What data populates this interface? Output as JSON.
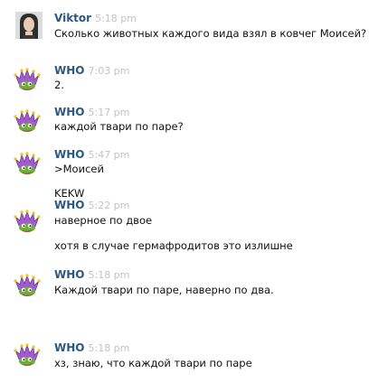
{
  "messages": [
    {
      "author": "Viktor",
      "time": "5:18 pm",
      "lines": [
        "Сколько животных каждого вида взял в ковчег Моисей?"
      ],
      "avatar": "woman-photo-avatar"
    },
    {
      "author": "WHO",
      "time": "7:03 pm",
      "lines": [
        "2."
      ],
      "avatar": "pepe-jester-avatar"
    },
    {
      "author": "WHO",
      "time": "5:17 pm",
      "lines": [
        "каждой твари по паре?"
      ],
      "avatar": "pepe-jester-avatar"
    },
    {
      "author": "WHO",
      "time": "5:47 pm",
      "lines": [
        ">Моисей",
        "KEKW"
      ],
      "avatar": "pepe-jester-avatar"
    },
    {
      "author": "WHO",
      "time": "5:22 pm",
      "lines": [
        "наверное по двое",
        "хотя в случае гермафродитов это излишне"
      ],
      "avatar": "pepe-jester-avatar"
    },
    {
      "author": "WHO",
      "time": "5:18 pm",
      "lines": [
        "Каждой твари по паре, наверно по два."
      ],
      "avatar": "pepe-jester-avatar"
    },
    {
      "author": "WHO",
      "time": "5:18 pm",
      "lines": [
        "хз, знаю, что каждой твари по паре"
      ],
      "avatar": "pepe-jester-avatar"
    }
  ],
  "colors": {
    "author": "#2a5885",
    "time": "#c3c3c3",
    "text": "#111111"
  }
}
